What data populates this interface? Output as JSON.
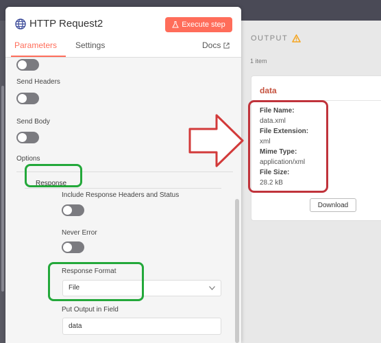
{
  "node": {
    "title": "HTTP Request2",
    "execute_label": "Execute step",
    "tabs": {
      "parameters": "Parameters",
      "settings": "Settings",
      "docs": "Docs"
    }
  },
  "params": {
    "send_headers": "Send Headers",
    "send_body": "Send Body",
    "options": "Options",
    "response": "Response",
    "include_headers": "Include Response Headers and Status",
    "never_error": "Never Error",
    "response_format_label": "Response Format",
    "response_format_value": "File",
    "put_output_label": "Put Output in Field",
    "put_output_value": "data"
  },
  "output": {
    "heading": "OUTPUT",
    "items_count": "1 item",
    "card_title": "data",
    "file_name_key": "File Name:",
    "file_name_val": "data.xml",
    "file_ext_key": "File Extension:",
    "file_ext_val": "xml",
    "mime_key": "Mime Type:",
    "mime_val": "application/xml",
    "size_key": "File Size:",
    "size_val": "28.2 kB",
    "download_label": "Download"
  },
  "colors": {
    "accent": "#ff6d5a",
    "highlight_green": "#23a83a",
    "highlight_red": "#c0333b",
    "warning": "#f5a623"
  }
}
